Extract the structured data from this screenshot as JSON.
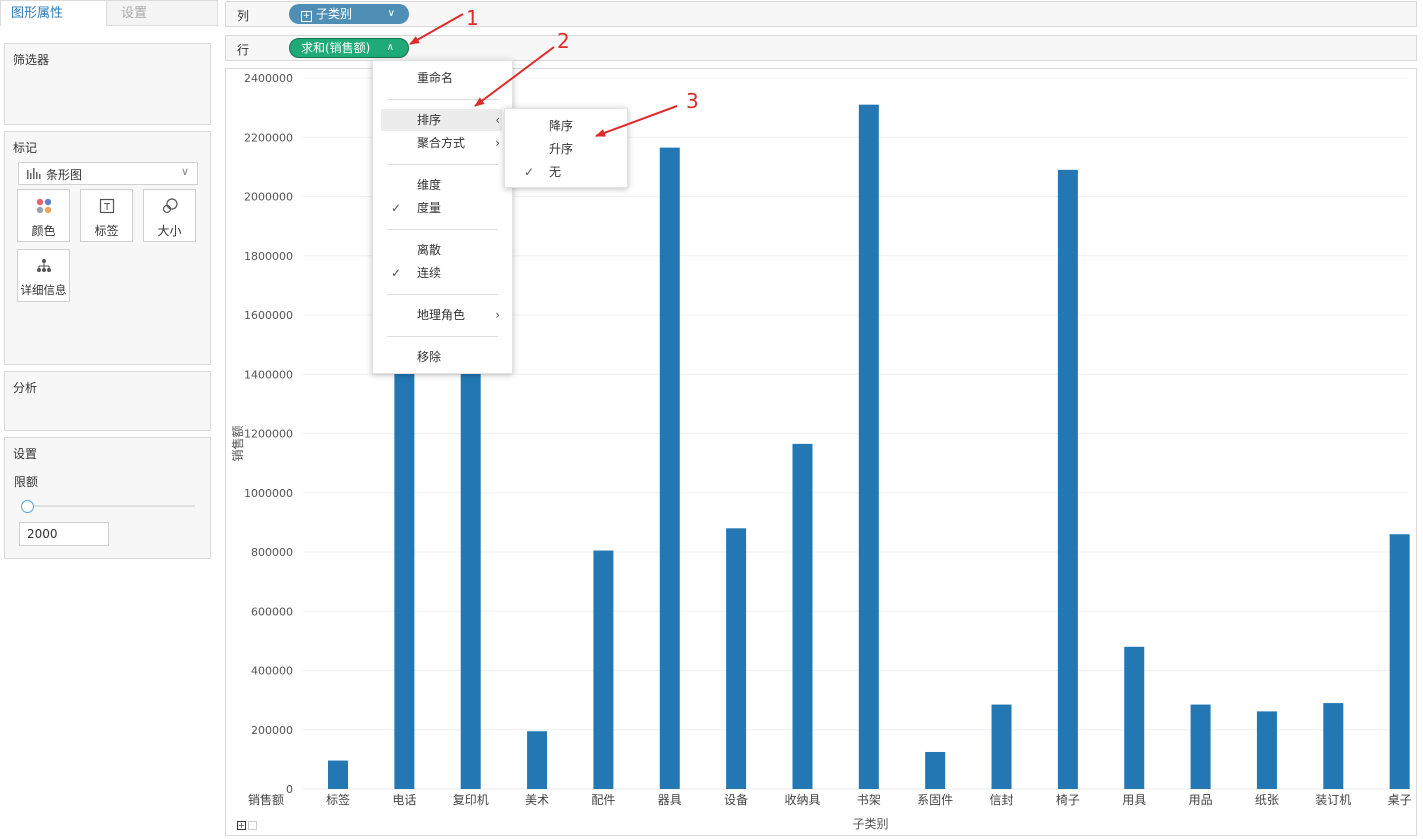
{
  "tabs": [
    {
      "label": "图形属性",
      "active": true
    },
    {
      "label": "设置",
      "active": false
    }
  ],
  "filters": {
    "title": "筛选器"
  },
  "marks": {
    "title": "标记",
    "type_label": "条形图",
    "buttons": [
      {
        "label": "颜色",
        "icon": "color-icon"
      },
      {
        "label": "标签",
        "icon": "label-icon"
      },
      {
        "label": "大小",
        "icon": "size-icon"
      },
      {
        "label": "详细信息",
        "icon": "detail-icon"
      }
    ]
  },
  "analysis": {
    "title": "分析"
  },
  "settings": {
    "title": "设置",
    "limit_label": "限额",
    "limit_value": "2000"
  },
  "shelves": {
    "columns": {
      "label": "列",
      "pill": "子类别"
    },
    "rows": {
      "label": "行",
      "pill": "求和(销售额)"
    }
  },
  "context_menu": {
    "items": [
      "重命名",
      "排序",
      "聚合方式",
      "维度",
      "度量",
      "离散",
      "连续",
      "地理角色",
      "移除"
    ],
    "checked": [
      "度量",
      "连续"
    ]
  },
  "sort_submenu": {
    "items": [
      "降序",
      "升序",
      "无"
    ],
    "checked": "无"
  },
  "annotations": [
    "1",
    "2",
    "3"
  ],
  "colors": {
    "bar": "#2378b4",
    "measure_pill": "#1faa78",
    "dimension_pill": "#4f8fb6",
    "annotation": "#e02b2b"
  },
  "chart_data": {
    "type": "bar",
    "xlabel": "子类别",
    "ylabel": "销售额",
    "corner_label": "销售额",
    "ylim": [
      0,
      2400000
    ],
    "yticks": [
      0,
      200000,
      400000,
      600000,
      800000,
      1000000,
      1200000,
      1400000,
      1600000,
      1800000,
      2000000,
      2200000,
      2400000
    ],
    "categories": [
      "标签",
      "电话",
      "复印机",
      "美术",
      "配件",
      "器具",
      "设备",
      "收纳具",
      "书架",
      "系固件",
      "信封",
      "椅子",
      "用具",
      "用品",
      "纸张",
      "装订机",
      "桌子"
    ],
    "values": [
      96000,
      1450000,
      1450000,
      195000,
      805000,
      2165000,
      880000,
      1165000,
      2310000,
      125000,
      285000,
      2090000,
      480000,
      285000,
      262000,
      290000,
      860000
    ],
    "grid": true
  }
}
